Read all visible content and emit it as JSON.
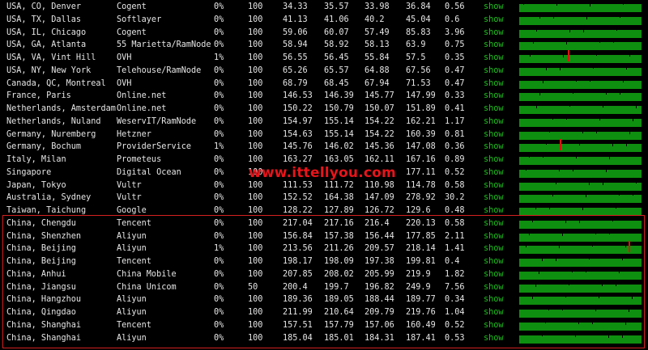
{
  "watermark": "www.ittellyou.com",
  "colors": {
    "background": "#000000",
    "show_link": "#1ec21e",
    "sparkline": "#0f8f0f",
    "spike": "#e01010",
    "highlight_border": "#d42020"
  },
  "rows": [
    {
      "location": "USA, CO, Denver",
      "provider": "Cogent",
      "loss": "0%",
      "snt": "100",
      "last": "34.33",
      "avg": "35.57",
      "best": "33.98",
      "wrst": "36.84",
      "stdev": "0.56",
      "action": "show",
      "spike": null
    },
    {
      "location": "USA, TX, Dallas",
      "provider": "Softlayer",
      "loss": "0%",
      "snt": "100",
      "last": "41.13",
      "avg": "41.06",
      "best": "40.2",
      "wrst": "45.04",
      "stdev": "0.6",
      "action": "show",
      "spike": null
    },
    {
      "location": "USA, IL, Chicago",
      "provider": "Cogent",
      "loss": "0%",
      "snt": "100",
      "last": "59.06",
      "avg": "60.07",
      "best": "57.49",
      "wrst": "85.83",
      "stdev": "3.96",
      "action": "show",
      "spike": null
    },
    {
      "location": "USA, GA, Atlanta",
      "provider": "55 Marietta/RamNode",
      "loss": "0%",
      "snt": "100",
      "last": "58.94",
      "avg": "58.92",
      "best": "58.13",
      "wrst": "63.9",
      "stdev": "0.75",
      "action": "show",
      "spike": null
    },
    {
      "location": "USA, VA, Vint Hill",
      "provider": "OVH",
      "loss": "1%",
      "snt": "100",
      "last": "56.55",
      "avg": "56.45",
      "best": "55.84",
      "wrst": "57.5",
      "stdev": "0.35",
      "action": "show",
      "spike": 0.4
    },
    {
      "location": "USA, NY, New York",
      "provider": "Telehouse/RamNode",
      "loss": "0%",
      "snt": "100",
      "last": "65.26",
      "avg": "65.57",
      "best": "64.88",
      "wrst": "67.56",
      "stdev": "0.47",
      "action": "show",
      "spike": null
    },
    {
      "location": "Canada, QC, Montreal",
      "provider": "OVH",
      "loss": "0%",
      "snt": "100",
      "last": "68.79",
      "avg": "68.45",
      "best": "67.94",
      "wrst": "71.53",
      "stdev": "0.47",
      "action": "show",
      "spike": null
    },
    {
      "location": "France, Paris",
      "provider": "Online.net",
      "loss": "0%",
      "snt": "100",
      "last": "146.53",
      "avg": "146.39",
      "best": "145.77",
      "wrst": "147.99",
      "stdev": "0.33",
      "action": "show",
      "spike": null
    },
    {
      "location": "Netherlands, Amsterdam",
      "provider": "Online.net",
      "loss": "0%",
      "snt": "100",
      "last": "150.22",
      "avg": "150.79",
      "best": "150.07",
      "wrst": "151.89",
      "stdev": "0.41",
      "action": "show",
      "spike": null
    },
    {
      "location": "Netherlands, Nuland",
      "provider": "WeservIT/RamNode",
      "loss": "0%",
      "snt": "100",
      "last": "154.97",
      "avg": "155.14",
      "best": "154.22",
      "wrst": "162.21",
      "stdev": "1.17",
      "action": "show",
      "spike": null
    },
    {
      "location": "Germany, Nuremberg",
      "provider": "Hetzner",
      "loss": "0%",
      "snt": "100",
      "last": "154.63",
      "avg": "155.14",
      "best": "154.22",
      "wrst": "160.39",
      "stdev": "0.81",
      "action": "show",
      "spike": null
    },
    {
      "location": "Germany, Bochum",
      "provider": "ProviderService",
      "loss": "1%",
      "snt": "100",
      "last": "145.76",
      "avg": "146.02",
      "best": "145.36",
      "wrst": "147.08",
      "stdev": "0.36",
      "action": "show",
      "spike": 0.33
    },
    {
      "location": "Italy, Milan",
      "provider": "Prometeus",
      "loss": "0%",
      "snt": "100",
      "last": "163.27",
      "avg": "163.05",
      "best": "162.11",
      "wrst": "167.16",
      "stdev": "0.89",
      "action": "show",
      "spike": null
    },
    {
      "location": "Singapore",
      "provider": "Digital Ocean",
      "loss": "0%",
      "snt": "100",
      "last": "",
      "avg": "",
      "best": "",
      "wrst": "177.11",
      "stdev": "0.52",
      "action": "show",
      "spike": null
    },
    {
      "location": "Japan, Tokyo",
      "provider": "Vultr",
      "loss": "0%",
      "snt": "100",
      "last": "111.53",
      "avg": "111.72",
      "best": "110.98",
      "wrst": "114.78",
      "stdev": "0.58",
      "action": "show",
      "spike": null
    },
    {
      "location": "Australia, Sydney",
      "provider": "Vultr",
      "loss": "0%",
      "snt": "100",
      "last": "152.52",
      "avg": "164.38",
      "best": "147.09",
      "wrst": "278.92",
      "stdev": "30.2",
      "action": "show",
      "spike": null
    },
    {
      "location": "Taiwan, Taichung",
      "provider": "Google",
      "loss": "0%",
      "snt": "100",
      "last": "128.22",
      "avg": "127.89",
      "best": "126.72",
      "wrst": "129.6",
      "stdev": "0.48",
      "action": "show",
      "spike": null
    },
    {
      "location": "China, Chengdu",
      "provider": "Tencent",
      "loss": "0%",
      "snt": "100",
      "last": "217.04",
      "avg": "217.16",
      "best": "216.4",
      "wrst": "220.13",
      "stdev": "0.58",
      "action": "show",
      "spike": null
    },
    {
      "location": "China, Shenzhen",
      "provider": "Aliyun",
      "loss": "0%",
      "snt": "100",
      "last": "156.84",
      "avg": "157.38",
      "best": "156.44",
      "wrst": "177.85",
      "stdev": "2.11",
      "action": "show",
      "spike": null
    },
    {
      "location": "China, Beijing",
      "provider": "Aliyun",
      "loss": "1%",
      "snt": "100",
      "last": "213.56",
      "avg": "211.26",
      "best": "209.57",
      "wrst": "218.14",
      "stdev": "1.41",
      "action": "show",
      "spike": 0.9
    },
    {
      "location": "China, Beijing",
      "provider": "Tencent",
      "loss": "0%",
      "snt": "100",
      "last": "198.17",
      "avg": "198.09",
      "best": "197.38",
      "wrst": "199.81",
      "stdev": "0.4",
      "action": "show",
      "spike": null
    },
    {
      "location": "China, Anhui",
      "provider": "China Mobile",
      "loss": "0%",
      "snt": "100",
      "last": "207.85",
      "avg": "208.02",
      "best": "205.99",
      "wrst": "219.9",
      "stdev": "1.82",
      "action": "show",
      "spike": null
    },
    {
      "location": "China, Jiangsu",
      "provider": "China Unicom",
      "loss": "0%",
      "snt": "50",
      "last": "200.4",
      "avg": "199.7",
      "best": "196.82",
      "wrst": "249.9",
      "stdev": "7.56",
      "action": "show",
      "spike": null
    },
    {
      "location": "China, Hangzhou",
      "provider": "Aliyun",
      "loss": "0%",
      "snt": "100",
      "last": "189.36",
      "avg": "189.05",
      "best": "188.44",
      "wrst": "189.77",
      "stdev": "0.34",
      "action": "show",
      "spike": null
    },
    {
      "location": "China, Qingdao",
      "provider": "Aliyun",
      "loss": "0%",
      "snt": "100",
      "last": "211.99",
      "avg": "210.64",
      "best": "209.79",
      "wrst": "219.76",
      "stdev": "1.04",
      "action": "show",
      "spike": null
    },
    {
      "location": "China, Shanghai",
      "provider": "Tencent",
      "loss": "0%",
      "snt": "100",
      "last": "157.51",
      "avg": "157.79",
      "best": "157.06",
      "wrst": "160.49",
      "stdev": "0.52",
      "action": "show",
      "spike": null
    },
    {
      "location": "China, Shanghai",
      "provider": "Aliyun",
      "loss": "0%",
      "snt": "100",
      "last": "185.04",
      "avg": "185.01",
      "best": "184.31",
      "wrst": "187.41",
      "stdev": "0.53",
      "action": "show",
      "spike": null
    }
  ]
}
